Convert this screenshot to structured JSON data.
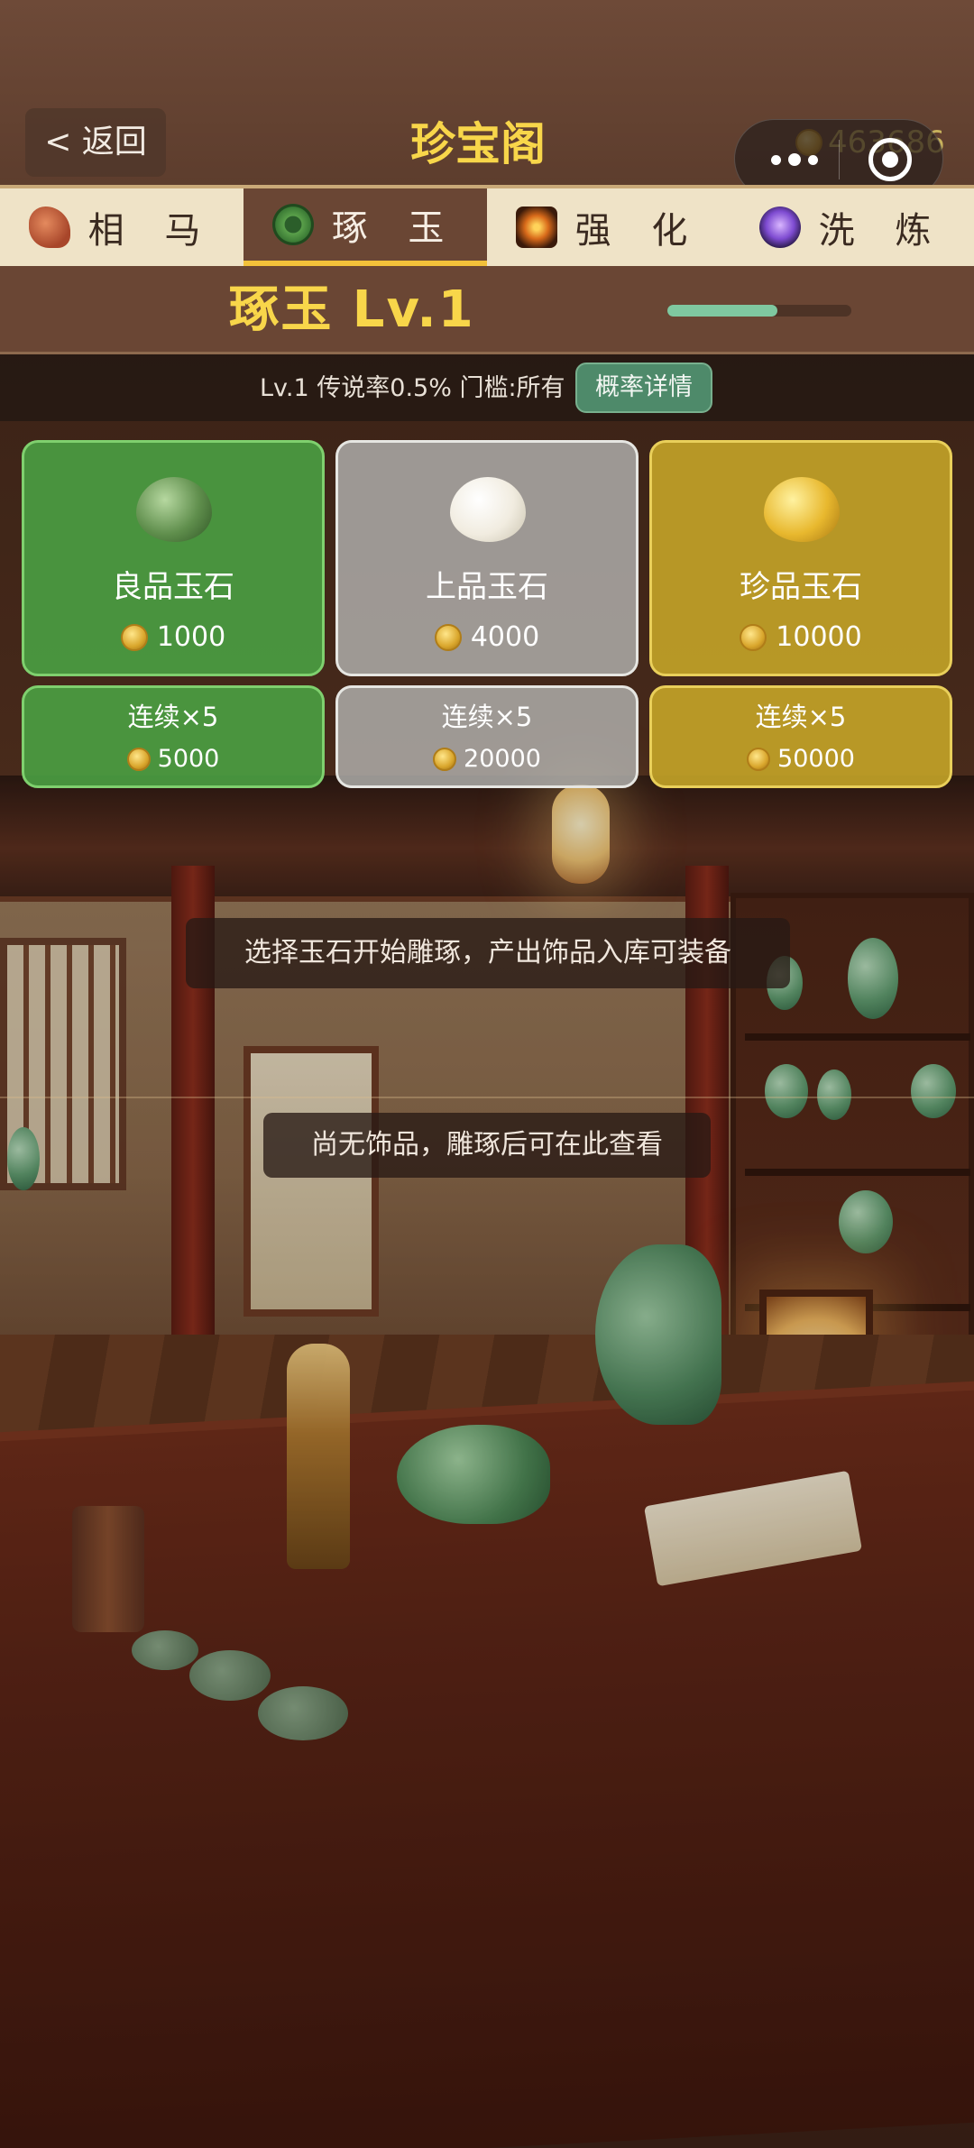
{
  "header": {
    "back_label": "< 返回",
    "title": "珍宝阁",
    "coin_balance": "463686"
  },
  "tabs": [
    {
      "label": "相 马",
      "icon": "horse-icon",
      "active": false
    },
    {
      "label": "琢 玉",
      "icon": "jade-ring-icon",
      "active": true
    },
    {
      "label": "强 化",
      "icon": "forge-icon",
      "active": false
    },
    {
      "label": "洗 炼",
      "icon": "purple-orb-icon",
      "active": false
    }
  ],
  "level": {
    "title": "琢玉  Lv.1",
    "progress_fraction": 0.6
  },
  "info": {
    "text": "Lv.1 传说率0.5%  门槛:所有",
    "detail_button": "概率详情"
  },
  "stones": [
    {
      "name": "良品玉石",
      "price": "1000",
      "combo_label": "连续×5",
      "combo_price": "5000",
      "color": "#4aa042"
    },
    {
      "name": "上品玉石",
      "price": "4000",
      "combo_label": "连续×5",
      "combo_price": "20000",
      "color": "#b2b2b0"
    },
    {
      "name": "珍品玉石",
      "price": "10000",
      "combo_label": "连续×5",
      "combo_price": "50000",
      "color": "#c4a428"
    }
  ],
  "messages": {
    "hint": "选择玉石开始雕琢，产出饰品入库可装备",
    "empty": "尚无饰品，雕琢后可在此查看"
  },
  "colors": {
    "title_yellow": "#f8d64a",
    "tab_active_bg": "#6a4634",
    "tab_bar_bg": "#efe3c7",
    "progress": "#7fc8a0"
  }
}
